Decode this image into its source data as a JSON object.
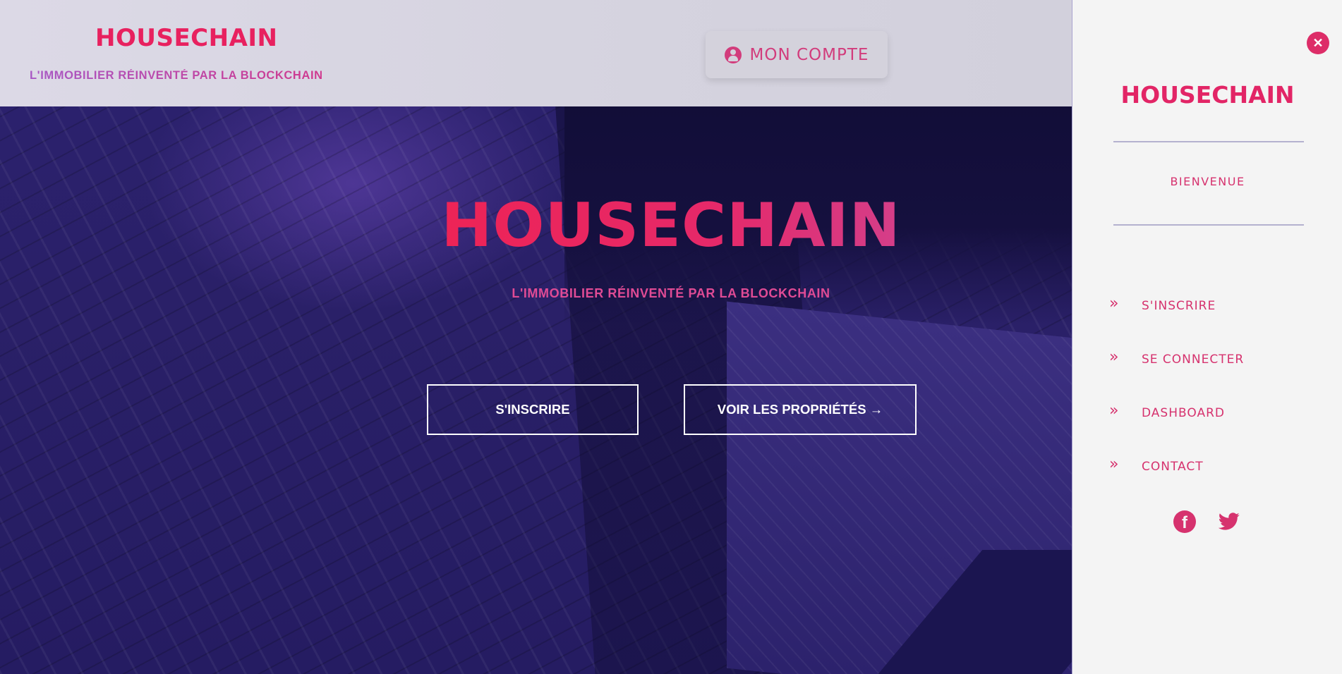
{
  "brand": "HOUSECHAIN",
  "tagline": "L'IMMOBILIER RÉINVENTÉ PAR LA BLOCKCHAIN",
  "header": {
    "logo": "HOUSECHAIN",
    "tagline": "L'IMMOBILIER RÉINVENTÉ PAR LA BLOCKCHAIN",
    "account_label": "MON COMPTE",
    "account_icon": "user-circle-icon"
  },
  "hero": {
    "title": "HOUSECHAIN",
    "subtitle": "L'IMMOBILIER RÉINVENTÉ PAR LA BLOCKCHAIN",
    "signup_label": "S'INSCRIRE",
    "properties_label": "VOIR LES PROPRIÉTÉS →"
  },
  "sidebar": {
    "close_icon": "close-icon",
    "logo": "HOUSECHAIN",
    "welcome": "BIENVENUE",
    "items": [
      {
        "label": "S'INSCRIRE",
        "icon": "double-chevron-right-icon"
      },
      {
        "label": "SE CONNECTER",
        "icon": "double-chevron-right-icon"
      },
      {
        "label": "DASHBOARD",
        "icon": "double-chevron-right-icon"
      },
      {
        "label": "CONTACT",
        "icon": "double-chevron-right-icon"
      }
    ],
    "social": [
      "facebook-icon",
      "twitter-icon"
    ]
  },
  "colors": {
    "brand_pink": "#e8215f",
    "accent_magenta": "#d6326e",
    "hero_bg": "#2a2068",
    "panel_bg": "#f4f4f4"
  }
}
